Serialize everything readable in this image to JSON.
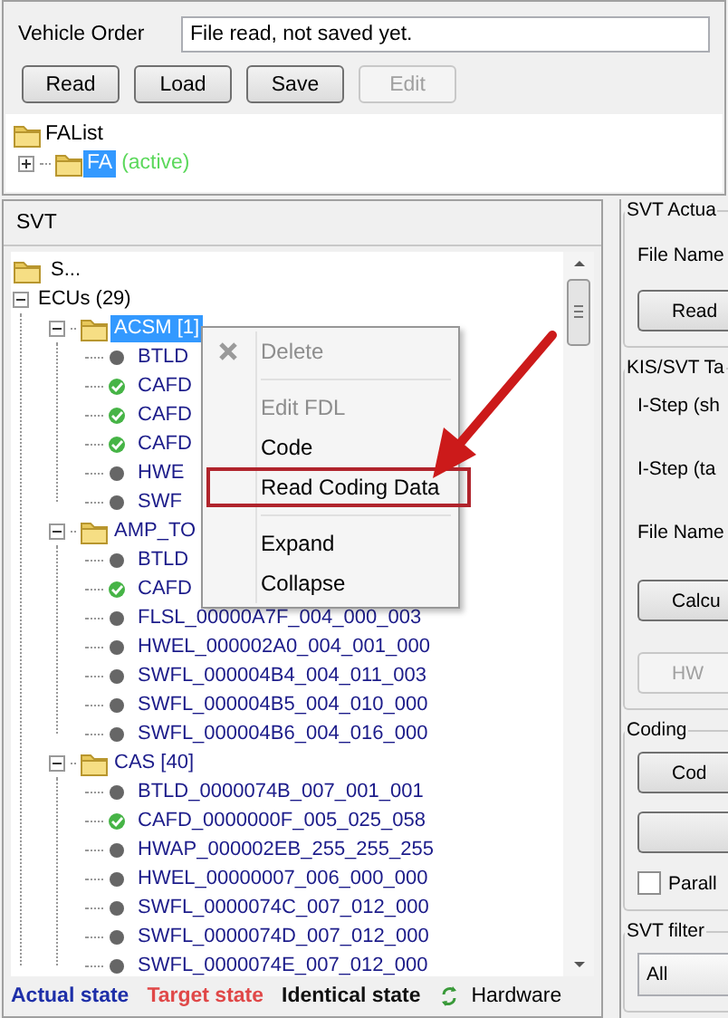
{
  "vehicle_order": {
    "label": "Vehicle Order",
    "value": "File read, not saved yet.",
    "buttons": [
      {
        "label": "Read",
        "disabled": false
      },
      {
        "label": "Load",
        "disabled": false
      },
      {
        "label": "Save",
        "disabled": false
      },
      {
        "label": "Edit",
        "disabled": true
      }
    ],
    "fa_tree": [
      {
        "label": "FAList",
        "selected": false,
        "children": [
          {
            "label": "FA",
            "note": "(active)",
            "selected": true,
            "expanded": false
          }
        ]
      }
    ]
  },
  "svt": {
    "title": "SVT",
    "tree": [
      {
        "label": "S...",
        "kind": "root",
        "selected": false
      },
      {
        "label": "ECUs (29)",
        "kind": "group",
        "selected": false,
        "expanded": true,
        "children": [
          {
            "label": "ACSM [1]",
            "kind": "ecu",
            "selected": true,
            "expanded": true,
            "children": [
              {
                "label": "BTLD",
                "kind": "unit",
                "ok": false,
                "selected": false
              },
              {
                "label": "CAFD",
                "kind": "unit",
                "ok": true,
                "selected": false
              },
              {
                "label": "CAFD",
                "kind": "unit",
                "ok": true,
                "selected": false
              },
              {
                "label": "CAFD",
                "kind": "unit",
                "ok": true,
                "selected": false
              },
              {
                "label": "HWE",
                "kind": "unit",
                "ok": false,
                "selected": false
              },
              {
                "label": "SWF",
                "kind": "unit",
                "ok": false,
                "selected": false
              }
            ]
          },
          {
            "label": "AMP_TO",
            "kind": "ecu",
            "selected": false,
            "expanded": true,
            "children": [
              {
                "label": "BTLD",
                "kind": "unit",
                "ok": false,
                "selected": false
              },
              {
                "label": "CAFD",
                "kind": "unit",
                "ok": true,
                "selected": false
              },
              {
                "label": "FLSL_00000A7F_004_000_003",
                "kind": "unit",
                "ok": false,
                "selected": false
              },
              {
                "label": "HWEL_000002A0_004_001_000",
                "kind": "unit",
                "ok": false,
                "selected": false
              },
              {
                "label": "SWFL_000004B4_004_011_003",
                "kind": "unit",
                "ok": false,
                "selected": false
              },
              {
                "label": "SWFL_000004B5_004_010_000",
                "kind": "unit",
                "ok": false,
                "selected": false
              },
              {
                "label": "SWFL_000004B6_004_016_000",
                "kind": "unit",
                "ok": false,
                "selected": false
              }
            ]
          },
          {
            "label": "CAS [40]",
            "kind": "ecu",
            "selected": false,
            "expanded": true,
            "children": [
              {
                "label": "BTLD_0000074B_007_001_001",
                "kind": "unit",
                "ok": false,
                "selected": false
              },
              {
                "label": "CAFD_0000000F_005_025_058",
                "kind": "unit",
                "ok": true,
                "selected": false
              },
              {
                "label": "HWAP_000002EB_255_255_255",
                "kind": "unit",
                "ok": false,
                "selected": false
              },
              {
                "label": "HWEL_00000007_006_000_000",
                "kind": "unit",
                "ok": false,
                "selected": false
              },
              {
                "label": "SWFL_0000074C_007_012_000",
                "kind": "unit",
                "ok": false,
                "selected": false
              },
              {
                "label": "SWFL_0000074D_007_012_000",
                "kind": "unit",
                "ok": false,
                "selected": false
              },
              {
                "label": "SWFL_0000074E_007_012_000",
                "kind": "unit",
                "ok": false,
                "selected": false
              }
            ]
          }
        ]
      }
    ],
    "legend": [
      {
        "label": "Actual state",
        "kind": "actual"
      },
      {
        "label": "Target state",
        "kind": "target"
      },
      {
        "label": "Identical state",
        "kind": "identical"
      },
      {
        "label": "Hardware",
        "kind": "hardware"
      }
    ]
  },
  "context_menu": [
    {
      "kind": "item",
      "label": "Delete",
      "disabled": true,
      "highlighted": false
    },
    {
      "kind": "separator"
    },
    {
      "kind": "item",
      "label": "Edit FDL",
      "disabled": true,
      "highlighted": false
    },
    {
      "kind": "item",
      "label": "Code",
      "disabled": false,
      "highlighted": false
    },
    {
      "kind": "item",
      "label": "Read Coding Data",
      "disabled": false,
      "highlighted": true
    },
    {
      "kind": "separator"
    },
    {
      "kind": "item",
      "label": "Expand",
      "disabled": false,
      "highlighted": false
    },
    {
      "kind": "item",
      "label": "Collapse",
      "disabled": false,
      "highlighted": false
    }
  ],
  "side_groups": [
    {
      "title": "SVT Actua",
      "items": [
        {
          "kind": "label",
          "text": "File Name"
        },
        {
          "kind": "button",
          "text": "Read",
          "disabled": false
        }
      ]
    },
    {
      "title": "KIS/SVT Ta",
      "items": [
        {
          "kind": "label",
          "text": "I-Step (sh"
        },
        {
          "kind": "label",
          "text": "I-Step (ta"
        },
        {
          "kind": "label",
          "text": "File Name"
        },
        {
          "kind": "button",
          "text": "Calcu",
          "disabled": false
        },
        {
          "kind": "button",
          "text": "HW",
          "disabled": true
        }
      ]
    },
    {
      "title": "Coding",
      "items": [
        {
          "kind": "button",
          "text": "Cod",
          "disabled": false
        },
        {
          "kind": "button",
          "disabled": false
        },
        {
          "kind": "checkbox",
          "text": "Parall",
          "checked": false
        }
      ]
    },
    {
      "title": "SVT filter",
      "items": [
        {
          "kind": "select",
          "text": "All"
        }
      ]
    }
  ]
}
